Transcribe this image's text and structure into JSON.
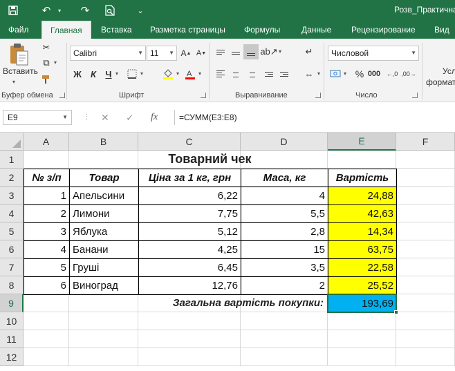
{
  "window": {
    "title": "Розв_Практична",
    "accent_color": "#217346"
  },
  "quick_access": [
    {
      "name": "save-icon",
      "glyph": "🖫"
    },
    {
      "name": "undo-icon",
      "glyph": "↶"
    },
    {
      "name": "redo-icon",
      "glyph": "↷"
    },
    {
      "name": "print-preview-icon",
      "glyph": "🔍"
    },
    {
      "name": "customize-icon",
      "glyph": "⌄"
    }
  ],
  "tabs": [
    "Файл",
    "Главная",
    "Вставка",
    "Разметка страницы",
    "Формулы",
    "Данные",
    "Рецензирование",
    "Вид"
  ],
  "active_tab": "Главная",
  "ribbon": {
    "clipboard": {
      "paste_label": "Вставить",
      "group_label": "Буфер обмена"
    },
    "font": {
      "font_name": "Calibri",
      "font_size": "11",
      "bold": "Ж",
      "italic": "К",
      "underline": "Ч",
      "group_label": "Шрифт"
    },
    "alignment": {
      "group_label": "Выравнивание"
    },
    "number": {
      "format": "Числовой",
      "percent": "%",
      "group_label": "Число"
    },
    "styles": {
      "line1": "Усл",
      "line2": "формат"
    }
  },
  "formula_bar": {
    "name_box": "E9",
    "cancel": "✕",
    "enter": "✓",
    "fx": "fx",
    "formula": "=СУММ(E3:E8)"
  },
  "sheet": {
    "columns": [
      "A",
      "B",
      "C",
      "D",
      "E",
      "F"
    ],
    "rows": [
      "1",
      "2",
      "3",
      "4",
      "5",
      "6",
      "7",
      "8",
      "9",
      "10",
      "11",
      "12"
    ],
    "selected_cell": "E9",
    "title": "Товарний чек",
    "headers": [
      "№ з/п",
      "Товар",
      "Ціна за 1 кг, грн",
      "Маса, кг",
      "Вартість"
    ],
    "data": [
      [
        "1",
        "Апельсини",
        "6,22",
        "4",
        "24,88"
      ],
      [
        "2",
        "Лимони",
        "7,75",
        "5,5",
        "42,63"
      ],
      [
        "3",
        "Яблука",
        "5,12",
        "2,8",
        "14,34"
      ],
      [
        "4",
        "Банани",
        "4,25",
        "15",
        "63,75"
      ],
      [
        "5",
        "Груші",
        "6,45",
        "3,5",
        "22,58"
      ],
      [
        "6",
        "Виноград",
        "12,76",
        "2",
        "25,52"
      ]
    ],
    "total_label": "Загальна вартість покупки:",
    "total_value": "193,69",
    "highlight_color": "#ffff00",
    "total_color": "#00b0f0"
  }
}
